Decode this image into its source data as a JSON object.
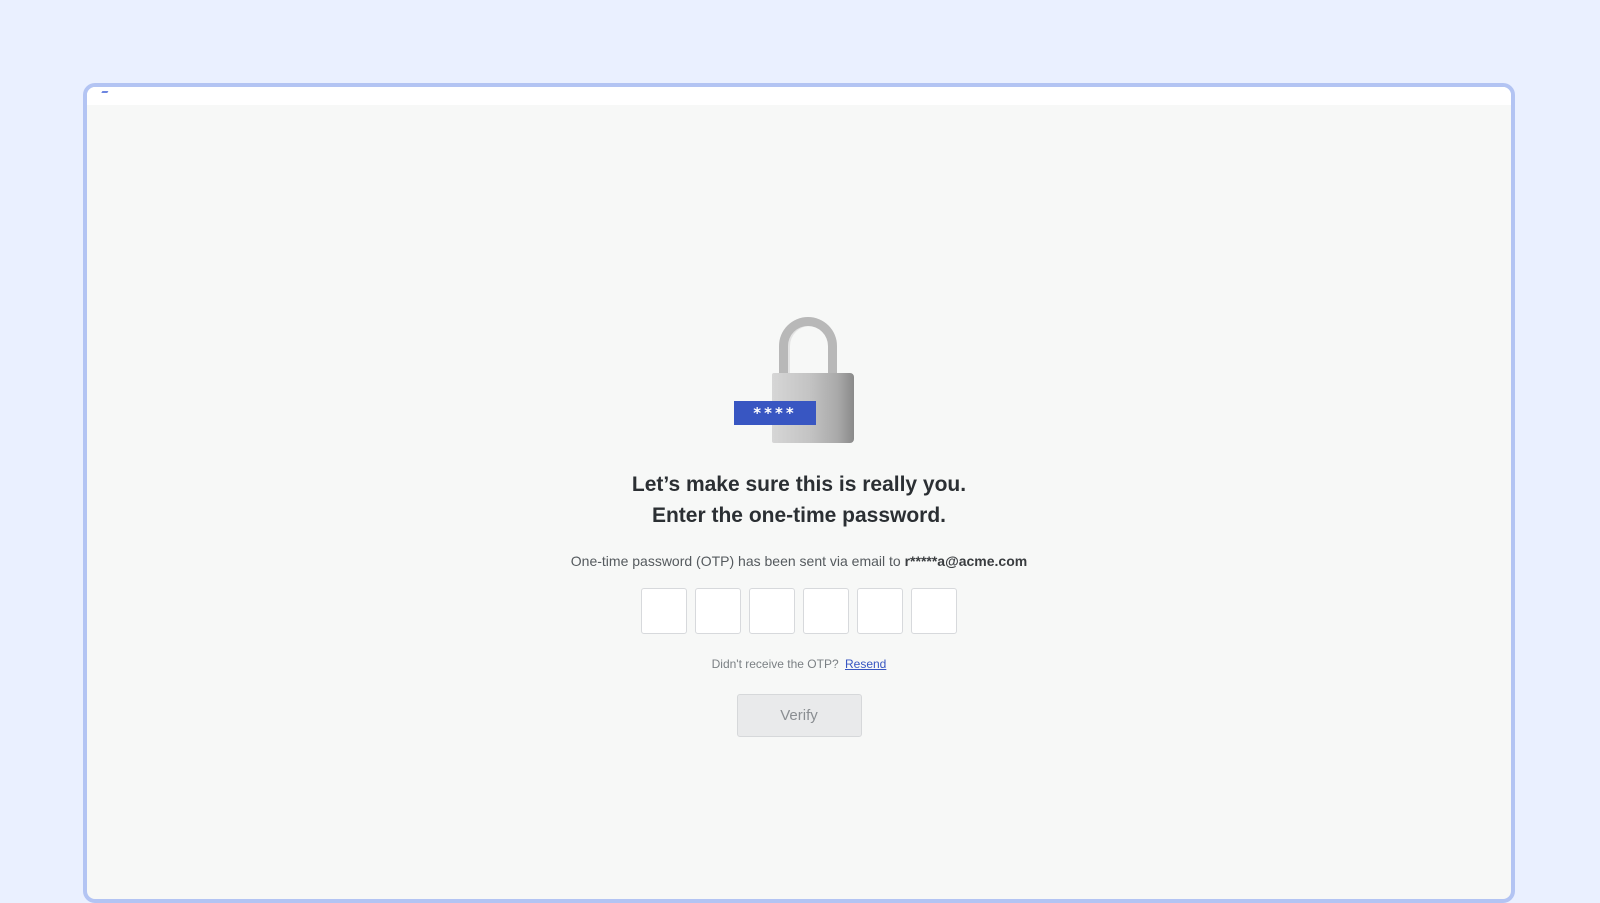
{
  "illustration": {
    "icon": "padlock-with-password-tag",
    "tag_text": "****",
    "tag_color": "#3856c2"
  },
  "heading": {
    "line1": "Let’s make sure this is really you.",
    "line2": "Enter the one-time password."
  },
  "message": {
    "prefix": "One-time password (OTP) has been sent via email to ",
    "email": "r*****a@acme.com"
  },
  "otp": {
    "digits": [
      "",
      "",
      "",
      "",
      "",
      ""
    ]
  },
  "resend": {
    "prompt": "Didn't receive the OTP?",
    "link_label": "Resend"
  },
  "verify": {
    "label": "Verify",
    "disabled": true
  },
  "colors": {
    "page_background": "#eaf0ff",
    "frame_border": "#b3c4f3",
    "card_background": "#f7f8f7",
    "accent": "#3856c2"
  }
}
